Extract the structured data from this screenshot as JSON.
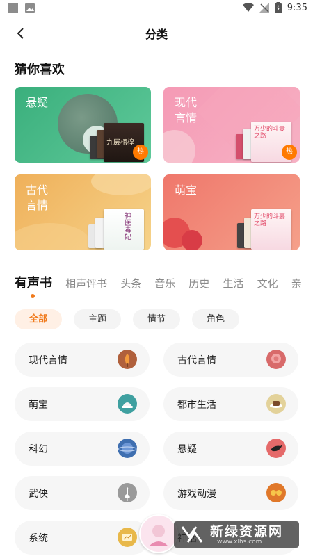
{
  "status_bar": {
    "time": "9:35"
  },
  "header": {
    "title": "分类"
  },
  "recommend": {
    "title": "猜你喜欢",
    "cards": [
      {
        "label": "悬疑",
        "hot": "热",
        "color": "#3fb784",
        "book_title": "九层棺椁"
      },
      {
        "label": "现代\n言情",
        "hot": "热",
        "color": "#f07aa0",
        "book_title": "万少的斗妻之路"
      },
      {
        "label": "古代\n言情",
        "color": "#e7b35a",
        "book_title": "神医毒妃"
      },
      {
        "label": "萌宝",
        "color": "#ef7f74",
        "book_title": "万少的斗妻之路"
      }
    ]
  },
  "tabs": {
    "items": [
      "有声书",
      "相声评书",
      "头条",
      "音乐",
      "历史",
      "生活",
      "文化",
      "亲"
    ],
    "active": 0
  },
  "chips": {
    "items": [
      "全部",
      "主题",
      "情节",
      "角色"
    ],
    "active": 0
  },
  "categories": [
    {
      "name": "现代言情",
      "icon": "rose-icon",
      "color": "#b0603c"
    },
    {
      "name": "古代言情",
      "icon": "peony-icon",
      "color": "#d86a6a"
    },
    {
      "name": "萌宝",
      "icon": "baby-hat-icon",
      "color": "#3fa0a0"
    },
    {
      "name": "都市生活",
      "icon": "coffee-icon",
      "color": "#e3d29a"
    },
    {
      "name": "科幻",
      "icon": "planet-icon",
      "color": "#3f6fb0"
    },
    {
      "name": "悬疑",
      "icon": "crow-icon",
      "color": "#e56a6a"
    },
    {
      "name": "武侠",
      "icon": "crane-icon",
      "color": "#9a9a9a"
    },
    {
      "name": "游戏动漫",
      "icon": "game-icon",
      "color": "#e0782a"
    },
    {
      "name": "系统",
      "icon": "screen-icon",
      "color": "#e8b84a"
    },
    {
      "name": "神话"
    }
  ],
  "watermark": {
    "text": "新绿资源网",
    "url": "www.xlhs.com"
  }
}
